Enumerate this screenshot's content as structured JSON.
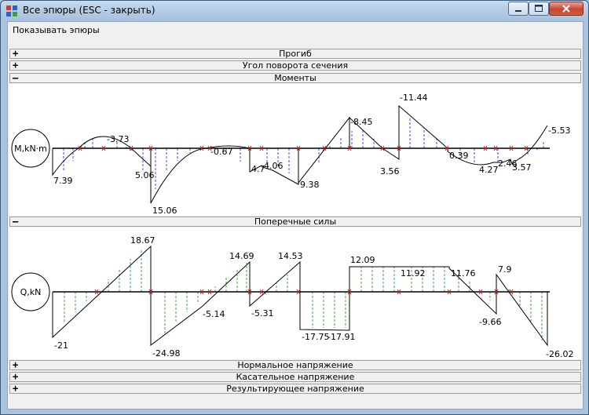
{
  "window": {
    "title": "Все эпюры (ESC - закрыть)",
    "accent_color": "#a9c6e3"
  },
  "menu": {
    "show_diagrams": "Показывать эпюры"
  },
  "sections": {
    "deflection": {
      "sign": "+",
      "label": "Прогиб"
    },
    "rotation": {
      "sign": "+",
      "label": "Угол поворота сечения"
    },
    "moments": {
      "sign": "–",
      "label": "Моменты"
    },
    "shear": {
      "sign": "–",
      "label": "Поперечные силы"
    },
    "normal_stress": {
      "sign": "+",
      "label": "Нормальное напряжение"
    },
    "shear_stress": {
      "sign": "+",
      "label": "Касательное напряжение"
    },
    "resultant_stress": {
      "sign": "+",
      "label": "Результирующее напряжение"
    }
  },
  "icons": [
    "app-icon",
    "minimize-icon",
    "maximize-icon",
    "close-icon",
    "expand-icon",
    "collapse-icon"
  ],
  "colors": {
    "moment_hatch": "#1a1aff",
    "shear_hatch": "#1a8c1a",
    "node_mark": "#cc2222"
  },
  "chart_data": [
    {
      "type": "line",
      "title": "Моменты",
      "ylabel": "M,kN·m",
      "x_range": [
        0,
        15
      ],
      "note": "positive values plotted below the axis",
      "segments": [
        {
          "points": [
            [
              0,
              7.39
            ],
            [
              0.5,
              -1.2
            ],
            [
              1,
              -3.73
            ],
            [
              1.5,
              -1.5
            ],
            [
              2,
              5.06
            ]
          ]
        },
        {
          "points": [
            [
              2,
              15.06
            ],
            [
              3,
              2.0
            ],
            [
              3.5,
              -0.67
            ],
            [
              4,
              4.7
            ]
          ]
        },
        {
          "points": [
            [
              4,
              4.7
            ],
            [
              4.5,
              4.06
            ],
            [
              5,
              9.38
            ]
          ]
        },
        {
          "points": [
            [
              5,
              9.38
            ],
            [
              6,
              -8.45
            ]
          ]
        },
        {
          "points": [
            [
              6,
              -8.45
            ],
            [
              7,
              3.56
            ]
          ]
        },
        {
          "points": [
            [
              7,
              -11.44
            ],
            [
              8,
              0.39
            ]
          ]
        },
        {
          "points": [
            [
              8,
              0.39
            ],
            [
              8.5,
              4.27
            ],
            [
              9,
              2.46
            ],
            [
              9.5,
              3.57
            ],
            [
              10,
              -5.53
            ]
          ]
        }
      ],
      "labels": [
        "7.39",
        "-3.73",
        "5.06",
        "15.06",
        "-0.67",
        "4.7",
        "4.06",
        "9.38",
        "-8.45",
        "3.56",
        "-11.44",
        "0.39",
        "4.27",
        "2.46",
        "3.57",
        "-5.53"
      ]
    },
    {
      "type": "line",
      "title": "Поперечные силы",
      "ylabel": "Q,kN",
      "x_range": [
        0,
        15
      ],
      "note": "negative values plotted below the axis",
      "segments": [
        {
          "points": [
            [
              0,
              -21
            ],
            [
              2,
              18.67
            ]
          ]
        },
        {
          "points": [
            [
              2,
              -24.98
            ],
            [
              3,
              -5.14
            ],
            [
              4,
              14.69
            ]
          ]
        },
        {
          "points": [
            [
              4,
              -5.31
            ],
            [
              5,
              14.53
            ]
          ]
        },
        {
          "points": [
            [
              5,
              -17.75
            ],
            [
              6,
              -17.91
            ]
          ]
        },
        {
          "points": [
            [
              6,
              12.09
            ],
            [
              7,
              11.92
            ],
            [
              8,
              11.76
            ],
            [
              9,
              -9.66
            ]
          ]
        },
        {
          "points": [
            [
              9,
              7.9
            ],
            [
              10,
              -26.02
            ]
          ]
        }
      ],
      "labels": [
        "-21",
        "18.67",
        "-24.98",
        "-5.14",
        "14.69",
        "-5.31",
        "14.53",
        "-17.75",
        "-17.91",
        "12.09",
        "11.92",
        "11.76",
        "-9.66",
        "7.9",
        "-26.02"
      ]
    }
  ]
}
